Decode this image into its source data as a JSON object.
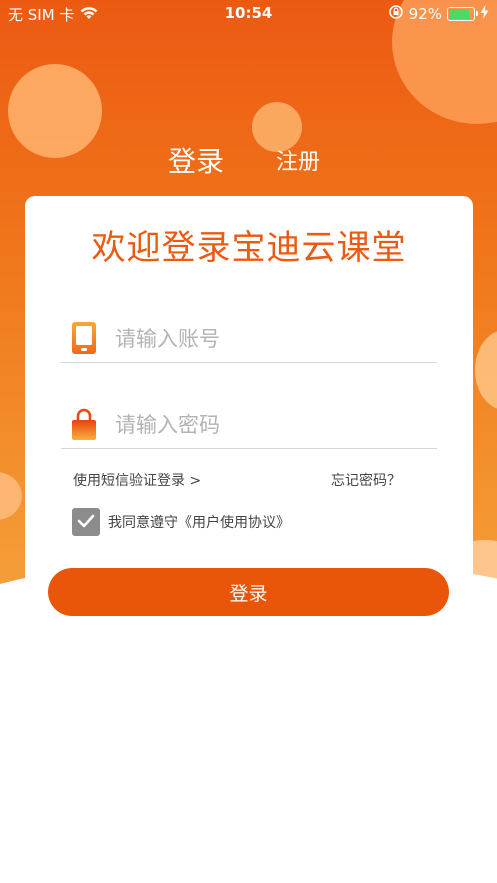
{
  "status_bar": {
    "carrier": "无 SIM 卡",
    "time": "10:54",
    "battery": "92%",
    "battery_level": 0.92
  },
  "tabs": {
    "login": "登录",
    "register": "注册"
  },
  "card": {
    "welcome": "欢迎登录宝迪云课堂",
    "account_placeholder": "请输入账号",
    "password_placeholder": "请输入密码",
    "sms_login": "使用短信验证登录 >",
    "forgot_password": "忘记密码？",
    "agreement": "我同意遵守《用户使用协议》",
    "agreement_checked": true
  },
  "login_button": "登录",
  "colors": {
    "accent": "#e9560a",
    "checkbox": "#8c8c8c",
    "battery": "#4cd964"
  },
  "icons": [
    "wifi-icon",
    "orientation-lock-icon",
    "charging-icon",
    "phone-icon",
    "lock-icon",
    "checkmark-icon"
  ]
}
